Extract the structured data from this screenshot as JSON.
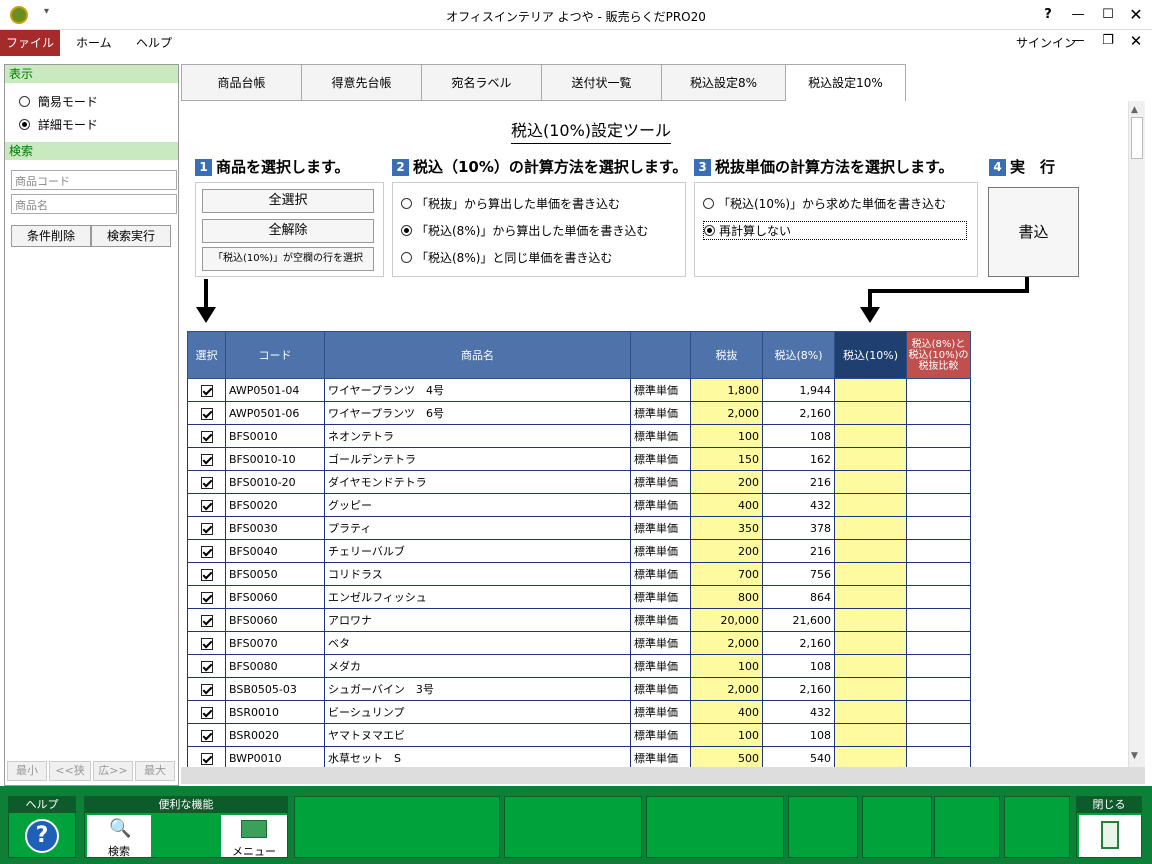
{
  "window": {
    "title": "オフィスインテリア よつや - 販売らくだPRO20",
    "help_btn": "?",
    "signin": "サインイン"
  },
  "menu": {
    "file": "ファイル",
    "home": "ホーム",
    "help": "ヘルプ"
  },
  "left": {
    "display_header": "表示",
    "mode_simple": "簡易モード",
    "mode_detail": "詳細モード",
    "search_header": "検索",
    "code_placeholder": "商品コード",
    "name_placeholder": "商品名",
    "clear_btn": "条件削除",
    "search_btn": "検索実行",
    "pager": {
      "min": "最小",
      "prev": "<<狭",
      "next": "広>>",
      "max": "最大"
    }
  },
  "tabs": [
    "商品台帳",
    "得意先台帳",
    "宛名ラベル",
    "送付状一覧",
    "税込設定8%",
    "税込設定10%"
  ],
  "tool": {
    "title": "税込(10%)設定ツール",
    "step1": {
      "num": "1",
      "title": "商品を選択します。",
      "select_all": "全選択",
      "deselect_all": "全解除",
      "select_blank": "「税込(10%)」が空欄の行を選択"
    },
    "step2": {
      "num": "2",
      "title": "税込（10%）の計算方法を選択します。",
      "opt1": "「税抜」から算出した単価を書き込む",
      "opt2": "「税込(8%)」から算出した単価を書き込む",
      "opt3": "「税込(8%)」と同じ単価を書き込む"
    },
    "step3": {
      "num": "3",
      "title": "税抜単価の計算方法を選択します。",
      "opt1": "「税込(10%)」から求めた単価を書き込む",
      "opt2": "再計算しない"
    },
    "step4": {
      "num": "4",
      "title": "実　行",
      "write_btn": "書込"
    }
  },
  "grid": {
    "headers": {
      "select": "選択",
      "code": "コード",
      "name": "商品名",
      "type": "",
      "taxex": "税抜",
      "tax8": "税込(8%)",
      "tax10": "税込(10%)",
      "compare": "税込(8%)と税込(10%)の税抜比較"
    },
    "rows": [
      {
        "code": "AWP0501-04",
        "name": "ワイヤープランツ　4号",
        "type": "標準単価",
        "taxex": "1,800",
        "tax8": "1,944"
      },
      {
        "code": "AWP0501-06",
        "name": "ワイヤープランツ　6号",
        "type": "標準単価",
        "taxex": "2,000",
        "tax8": "2,160"
      },
      {
        "code": "BFS0010",
        "name": "ネオンテトラ",
        "type": "標準単価",
        "taxex": "100",
        "tax8": "108"
      },
      {
        "code": "BFS0010-10",
        "name": "ゴールデンテトラ",
        "type": "標準単価",
        "taxex": "150",
        "tax8": "162"
      },
      {
        "code": "BFS0010-20",
        "name": "ダイヤモンドテトラ",
        "type": "標準単価",
        "taxex": "200",
        "tax8": "216"
      },
      {
        "code": "BFS0020",
        "name": "グッピー",
        "type": "標準単価",
        "taxex": "400",
        "tax8": "432"
      },
      {
        "code": "BFS0030",
        "name": "プラティ",
        "type": "標準単価",
        "taxex": "350",
        "tax8": "378"
      },
      {
        "code": "BFS0040",
        "name": "チェリーバルブ",
        "type": "標準単価",
        "taxex": "200",
        "tax8": "216"
      },
      {
        "code": "BFS0050",
        "name": "コリドラス",
        "type": "標準単価",
        "taxex": "700",
        "tax8": "756"
      },
      {
        "code": "BFS0060",
        "name": "エンゼルフィッシュ",
        "type": "標準単価",
        "taxex": "800",
        "tax8": "864"
      },
      {
        "code": "BFS0060",
        "name": "アロワナ",
        "type": "標準単価",
        "taxex": "20,000",
        "tax8": "21,600"
      },
      {
        "code": "BFS0070",
        "name": "ベタ",
        "type": "標準単価",
        "taxex": "2,000",
        "tax8": "2,160"
      },
      {
        "code": "BFS0080",
        "name": "メダカ",
        "type": "標準単価",
        "taxex": "100",
        "tax8": "108"
      },
      {
        "code": "BSB0505-03",
        "name": "シュガーバイン　3号",
        "type": "標準単価",
        "taxex": "2,000",
        "tax8": "2,160"
      },
      {
        "code": "BSR0010",
        "name": "ビーシュリンプ",
        "type": "標準単価",
        "taxex": "400",
        "tax8": "432"
      },
      {
        "code": "BSR0020",
        "name": "ヤマトヌマエビ",
        "type": "標準単価",
        "taxex": "100",
        "tax8": "108"
      },
      {
        "code": "BWP0010",
        "name": "水草セット　S",
        "type": "標準単価",
        "taxex": "500",
        "tax8": "540"
      }
    ]
  },
  "footer": {
    "help": "ヘルプ",
    "tools": "便利な機能",
    "search": "検索",
    "menu": "メニュー",
    "close": "閉じる"
  }
}
